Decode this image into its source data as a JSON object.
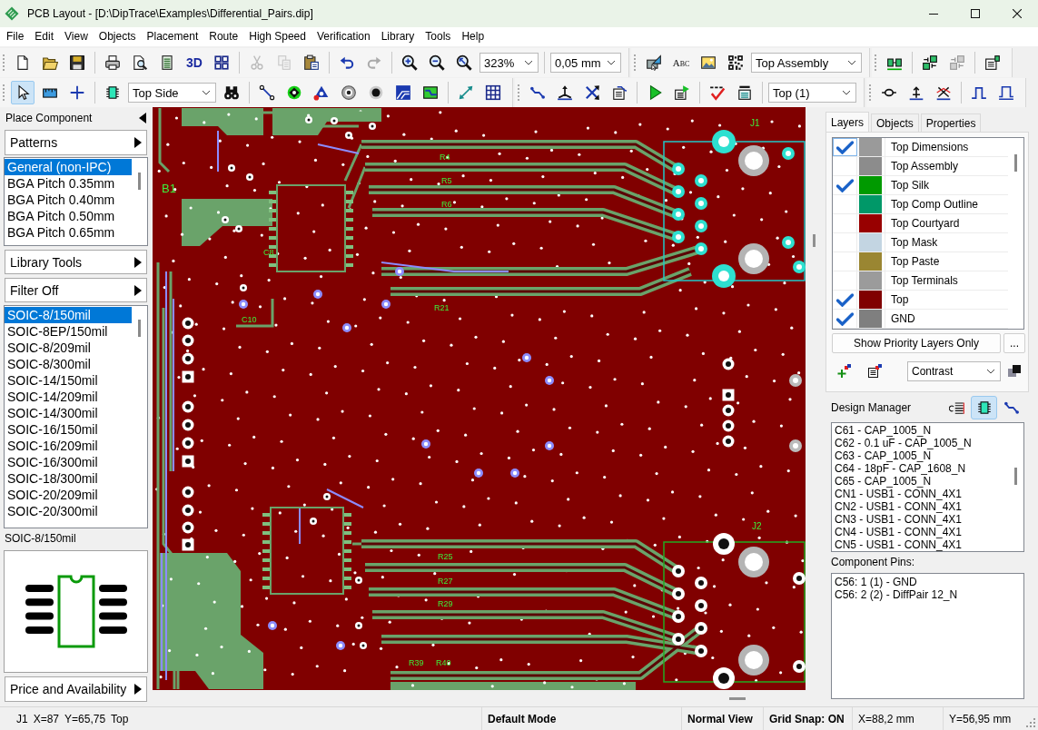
{
  "window": {
    "title": "PCB Layout - [D:\\DipTrace\\Examples\\Differential_Pairs.dip]"
  },
  "menu": [
    "File",
    "Edit",
    "View",
    "Objects",
    "Placement",
    "Route",
    "High Speed",
    "Verification",
    "Library",
    "Tools",
    "Help"
  ],
  "toolbars": [
    {
      "bands": [
        {
          "groups": [
            {
              "items": [
                {
                  "kind": "icon",
                  "disabled": false
                },
                {
                  "kind": "icon",
                  "disabled": false
                },
                {
                  "kind": "icon",
                  "disabled": false
                }
              ]
            },
            {
              "items": [
                {
                  "kind": "icon",
                  "disabled": false
                },
                {
                  "kind": "icon",
                  "disabled": false
                },
                {
                  "kind": "icon",
                  "disabled": false
                },
                {
                  "kind": "text",
                  "label": "3D",
                  "disabled": false
                },
                {
                  "kind": "icon",
                  "disabled": false
                }
              ]
            },
            {
              "items": [
                {
                  "kind": "icon",
                  "disabled": true
                },
                {
                  "kind": "icon",
                  "disabled": true
                },
                {
                  "kind": "icon",
                  "disabled": false
                }
              ]
            },
            {
              "items": [
                {
                  "kind": "icon",
                  "disabled": false
                },
                {
                  "kind": "icon",
                  "disabled": true
                }
              ]
            },
            {
              "items": [
                {
                  "kind": "icon",
                  "disabled": false
                },
                {
                  "kind": "icon",
                  "disabled": false
                },
                {
                  "kind": "icon",
                  "disabled": false
                },
                {
                  "kind": "combo",
                  "value": "323%"
                }
              ]
            },
            {
              "items": [
                {
                  "kind": "combo",
                  "value": "0,05 mm"
                }
              ]
            }
          ]
        },
        {
          "groups": [
            {
              "items": [
                {
                  "kind": "icon",
                  "disabled": false
                },
                {
                  "kind": "glyph",
                  "label": "ABC",
                  "disabled": false
                },
                {
                  "kind": "icon",
                  "disabled": false
                },
                {
                  "kind": "icon",
                  "disabled": false
                },
                {
                  "kind": "combo",
                  "value": "Top Assembly"
                }
              ]
            }
          ]
        },
        {
          "groups": [
            {
              "items": [
                {
                  "kind": "icon",
                  "disabled": false
                }
              ]
            },
            {
              "items": [
                {
                  "kind": "icon",
                  "disabled": false
                },
                {
                  "kind": "icon",
                  "disabled": true
                }
              ]
            },
            {
              "items": [
                {
                  "kind": "icon",
                  "disabled": false
                }
              ]
            }
          ]
        }
      ]
    },
    {
      "bands": [
        {
          "groups": [
            {
              "items": [
                {
                  "kind": "icon",
                  "disabled": false,
                  "selected": true
                },
                {
                  "kind": "icon",
                  "disabled": false,
                  "selected": false
                },
                {
                  "kind": "icon",
                  "disabled": false,
                  "selected": false
                }
              ]
            },
            {
              "items": [
                {
                  "kind": "icon",
                  "disabled": false
                },
                {
                  "kind": "combo",
                  "value": "Top Side"
                },
                {
                  "kind": "icon",
                  "disabled": false
                }
              ]
            },
            {
              "items": [
                {
                  "kind": "icon",
                  "disabled": false
                },
                {
                  "kind": "icon",
                  "disabled": false
                },
                {
                  "kind": "icon",
                  "disabled": false
                },
                {
                  "kind": "icon",
                  "disabled": false
                },
                {
                  "kind": "icon",
                  "disabled": false
                },
                {
                  "kind": "icon",
                  "disabled": false
                },
                {
                  "kind": "icon",
                  "disabled": false
                }
              ]
            },
            {
              "items": [
                {
                  "kind": "icon",
                  "disabled": false
                },
                {
                  "kind": "icon",
                  "disabled": false
                }
              ]
            }
          ]
        },
        {
          "groups": [
            {
              "items": [
                {
                  "kind": "icon",
                  "disabled": false
                },
                {
                  "kind": "icon",
                  "disabled": false
                },
                {
                  "kind": "icon",
                  "disabled": false
                },
                {
                  "kind": "icon",
                  "disabled": false
                }
              ]
            },
            {
              "items": [
                {
                  "kind": "icon",
                  "disabled": false
                },
                {
                  "kind": "icon",
                  "disabled": false
                }
              ]
            },
            {
              "items": [
                {
                  "kind": "icon",
                  "disabled": false
                },
                {
                  "kind": "icon",
                  "disabled": false
                }
              ]
            },
            {
              "items": [
                {
                  "kind": "combo",
                  "value": "Top (1)"
                }
              ]
            }
          ]
        },
        {
          "groups": [
            {
              "items": [
                {
                  "kind": "icon",
                  "disabled": false
                },
                {
                  "kind": "icon",
                  "disabled": false
                },
                {
                  "kind": "icon",
                  "disabled": false
                }
              ]
            },
            {
              "items": [
                {
                  "kind": "icon",
                  "disabled": false
                },
                {
                  "kind": "icon",
                  "disabled": false
                }
              ]
            }
          ]
        }
      ]
    }
  ],
  "left_panel": {
    "title": "Place Component",
    "patterns_button": "Patterns",
    "pattern_groups": [
      {
        "label": "General (non-IPC)",
        "selected": true
      },
      {
        "label": "BGA Pitch 0.35mm",
        "selected": false
      },
      {
        "label": "BGA Pitch 0.40mm",
        "selected": false
      },
      {
        "label": "BGA Pitch 0.50mm",
        "selected": false
      },
      {
        "label": "BGA Pitch 0.65mm",
        "selected": false
      }
    ],
    "library_tools_button": "Library Tools",
    "filter_button": "Filter Off",
    "patterns": [
      {
        "label": "SOIC-8/150mil",
        "selected": true
      },
      {
        "label": "SOIC-8EP/150mil",
        "selected": false
      },
      {
        "label": "SOIC-8/209mil",
        "selected": false
      },
      {
        "label": "SOIC-8/300mil",
        "selected": false
      },
      {
        "label": "SOIC-14/150mil",
        "selected": false
      },
      {
        "label": "SOIC-14/209mil",
        "selected": false
      },
      {
        "label": "SOIC-14/300mil",
        "selected": false
      },
      {
        "label": "SOIC-16/150mil",
        "selected": false
      },
      {
        "label": "SOIC-16/209mil",
        "selected": false
      },
      {
        "label": "SOIC-16/300mil",
        "selected": false
      },
      {
        "label": "SOIC-18/300mil",
        "selected": false
      },
      {
        "label": "SOIC-20/209mil",
        "selected": false
      },
      {
        "label": "SOIC-20/300mil",
        "selected": false
      }
    ],
    "preview_title": "SOIC-8/150mil",
    "price_button": "Price and Availability"
  },
  "pcb_canvas": {
    "labels": [
      "J1",
      "J2",
      "R4",
      "R5",
      "R6",
      "R21",
      "R25",
      "R27",
      "R29",
      "R39",
      "R40",
      "B1",
      "C8",
      "C10"
    ]
  },
  "right_panel": {
    "tabs": [
      {
        "label": "Layers",
        "selected": true
      },
      {
        "label": "Objects",
        "selected": false
      },
      {
        "label": "Properties",
        "selected": false
      }
    ],
    "layers": [
      {
        "name": "Top Dimensions",
        "checked": true,
        "focused": true,
        "color": "#9a9a9a"
      },
      {
        "name": "Top Assembly",
        "checked": false,
        "focused": false,
        "color": "#8c8c8c"
      },
      {
        "name": "Top Silk",
        "checked": true,
        "focused": false,
        "color": "#009a00"
      },
      {
        "name": "Top Comp Outline",
        "checked": false,
        "focused": false,
        "color": "#009868"
      },
      {
        "name": "Top Courtyard",
        "checked": false,
        "focused": false,
        "color": "#980000"
      },
      {
        "name": "Top Mask",
        "checked": false,
        "focused": false,
        "color": "#c3d5e2"
      },
      {
        "name": "Top Paste",
        "checked": false,
        "focused": false,
        "color": "#9a8632"
      },
      {
        "name": "Top Terminals",
        "checked": false,
        "focused": false,
        "color": "#9b9b9b"
      },
      {
        "name": "Top",
        "checked": true,
        "focused": false,
        "color": "#800000"
      },
      {
        "name": "GND",
        "checked": true,
        "focused": false,
        "color": "#7f7f7f"
      }
    ],
    "priority_button": "Show Priority Layers Only",
    "more_button": "...",
    "display_mode": "Contrast"
  },
  "design_manager": {
    "title": "Design Manager",
    "view_buttons": [
      {
        "selected": false
      },
      {
        "selected": true
      },
      {
        "selected": false
      }
    ],
    "components": [
      "C61 - CAP_1005_N",
      "C62 - 0.1 uF - CAP_1005_N",
      "C63 - CAP_1005_N",
      "C64 - 18pF - CAP_1608_N",
      "C65 - CAP_1005_N",
      "CN1 - USB1 - CONN_4X1",
      "CN2 - USB1 - CONN_4X1",
      "CN3 - USB1 - CONN_4X1",
      "CN4 - USB1 - CONN_4X1",
      "CN5 - USB1 - CONN_4X1"
    ],
    "pins_title": "Component Pins:",
    "pins": [
      "C56: 1 (1) - GND",
      "C56: 2 (2) - DiffPair 12_N"
    ]
  },
  "status_bar": {
    "cursor": [
      "J1",
      "X=87",
      "Y=65,75",
      "Top"
    ],
    "mode": "Default Mode",
    "view": "Normal View",
    "grid_snap": "Grid Snap: ON",
    "x": "X=88,2 mm",
    "y": "Y=56,95 mm"
  }
}
